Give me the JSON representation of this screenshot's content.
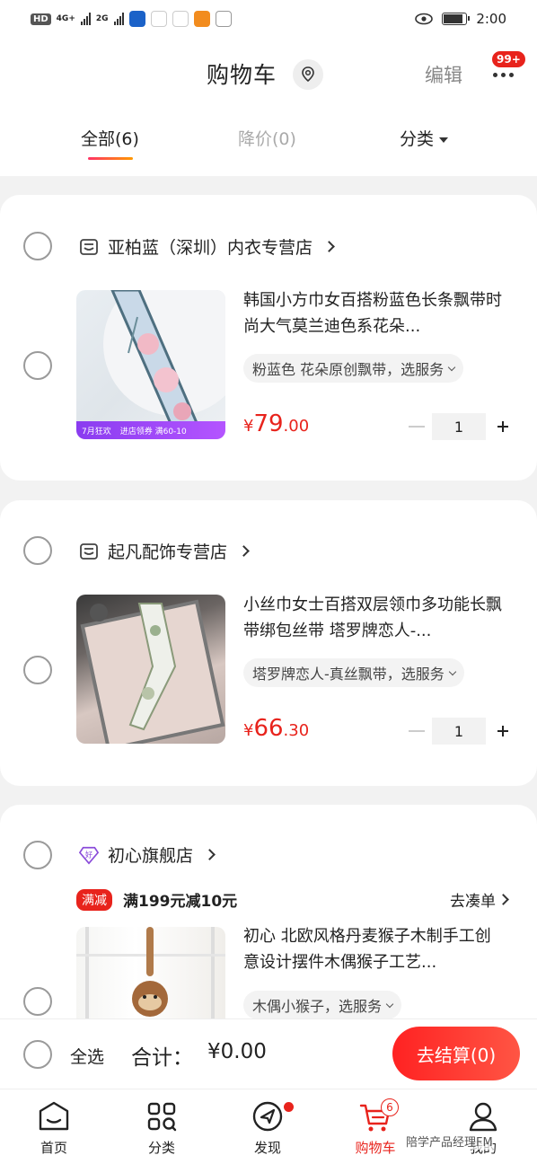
{
  "status_bar": {
    "hd": "HD",
    "net1": "4G+",
    "net2": "2G",
    "time": "2:00"
  },
  "header": {
    "title": "购物车",
    "edit": "编辑",
    "more_badge": "99+"
  },
  "tabs": [
    {
      "label": "全部(6)",
      "active": true
    },
    {
      "label": "降价(0)",
      "active": false
    },
    {
      "label": "分类",
      "active": false
    }
  ],
  "stores": [
    {
      "name": "亚柏蓝（深圳）内衣专营店",
      "item": {
        "title": "韩国小方巾女百搭粉蓝色长条飘带时尚大气莫兰迪色系花朵...",
        "sku": "粉蓝色 花朵原创飘带，选服务",
        "price_yen": "¥",
        "price_int": "79",
        "price_dec": ".00",
        "qty": "1",
        "image_band": [
          "7月狂欢",
          "进店领券 满60-10"
        ]
      }
    },
    {
      "name": "起凡配饰专营店",
      "item": {
        "title": "小丝巾女士百搭双层领巾多功能长飘带绑包丝带 塔罗牌恋人-...",
        "sku": "塔罗牌恋人-真丝飘带，选服务",
        "price_yen": "¥",
        "price_int": "66",
        "price_dec": ".30",
        "qty": "1"
      }
    },
    {
      "name": "初心旗舰店",
      "badge": "好",
      "promo": {
        "tag": "满减",
        "text": "满199元减10元",
        "link": "去凑单"
      },
      "item": {
        "title": "初心 北欧风格丹麦猴子木制手工创意设计摆件木偶猴子工艺...",
        "sku": "木偶小猴子，选服务"
      }
    }
  ],
  "summary": {
    "select_all": "全选",
    "total_label": "合计：",
    "total_value": "¥0.00",
    "checkout": "去结算(0)"
  },
  "tabbar": [
    {
      "label": "首页",
      "icon": "home-icon"
    },
    {
      "label": "分类",
      "icon": "category-icon"
    },
    {
      "label": "发现",
      "icon": "discover-icon"
    },
    {
      "label": "购物车",
      "icon": "cart-icon",
      "active": true,
      "badge": "6"
    },
    {
      "label": "我的",
      "icon": "profile-icon"
    }
  ],
  "watermark": "陪学产品经理FM",
  "colors": {
    "accent": "#e8231c",
    "promo_purple": "#8a3cf0"
  }
}
